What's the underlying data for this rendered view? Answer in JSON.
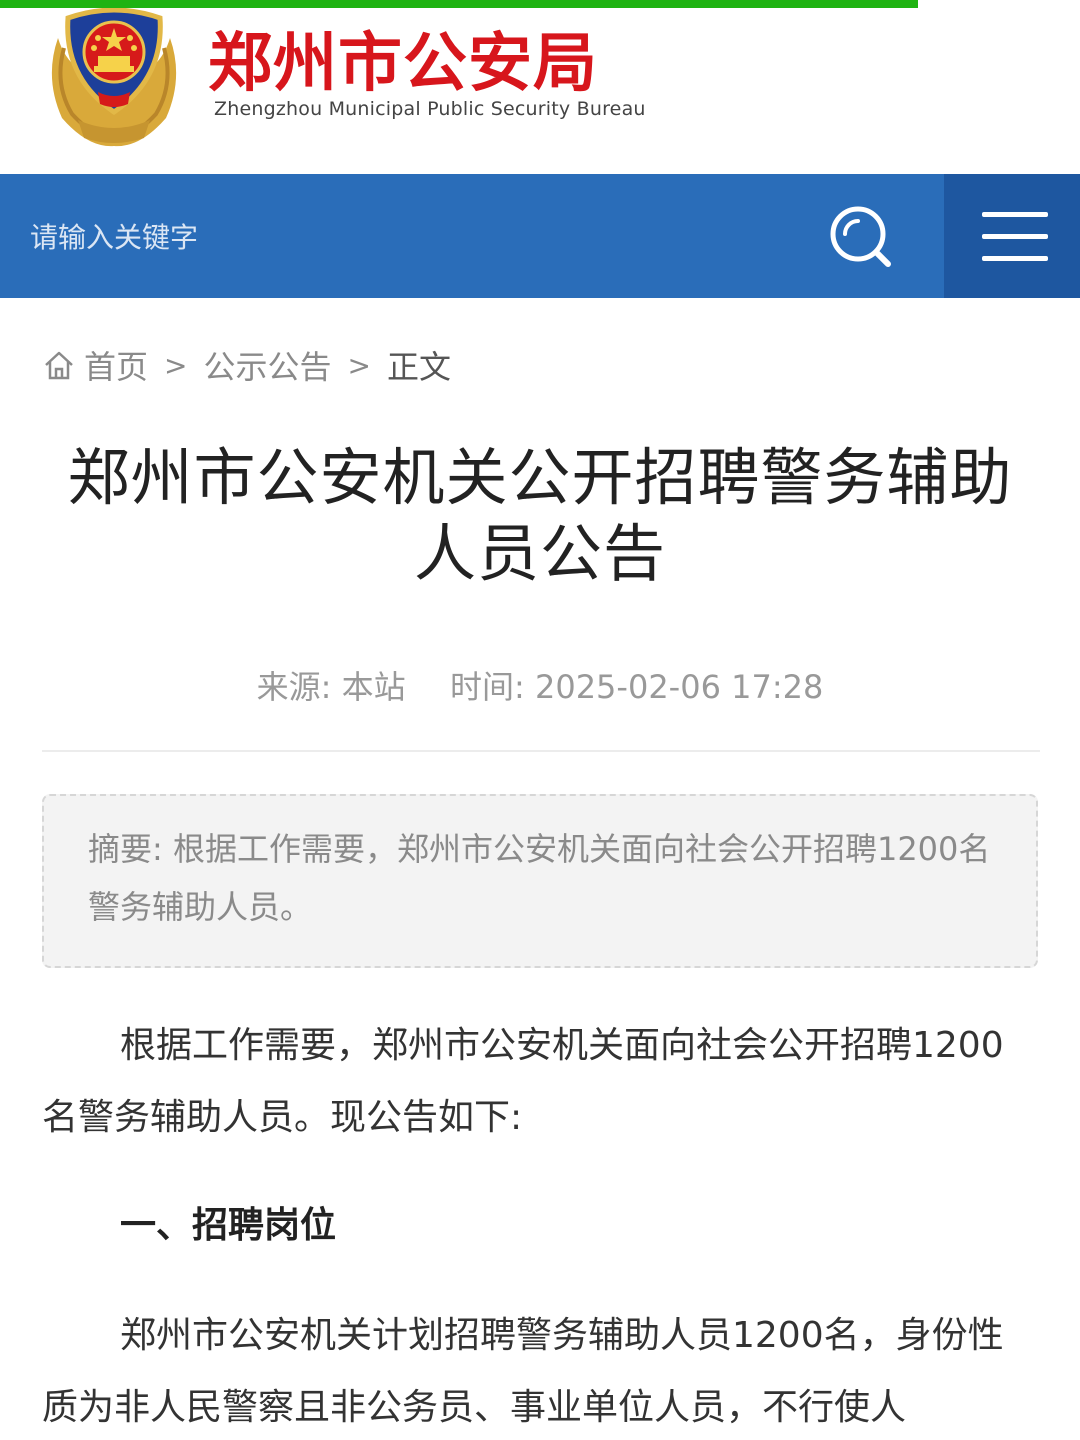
{
  "progress": {
    "fraction": 0.85,
    "color": "#1fb312"
  },
  "header": {
    "title": "郑州市公安局",
    "subtitle": "Zhengzhou Municipal Public Security Bureau",
    "emblem_icon": "police-emblem-icon",
    "title_color": "#d7161c"
  },
  "search": {
    "placeholder": "请输入关键字",
    "search_icon": "search-icon",
    "menu_icon": "hamburger-menu-icon",
    "bar_color": "#2a6db9"
  },
  "breadcrumb": {
    "home_icon": "home-icon",
    "items": [
      "首页",
      "公示公告",
      "正文"
    ],
    "separator": ">"
  },
  "article": {
    "title": "郑州市公安机关公开招聘警务辅助人员公告",
    "source_label": "来源:",
    "source": "本站",
    "time_label": "时间:",
    "time": "2025-02-06 17:28",
    "summary": "摘要: 根据工作需要，郑州市公安机关面向社会公开招聘1200名警务辅助人员。",
    "paragraph1": "根据工作需要，郑州市公安机关面向社会公开招聘1200名警务辅助人员。现公告如下:",
    "section1_heading": "一、招聘岗位",
    "paragraph2": "郑州市公安机关计划招聘警务辅助人员1200名，身份性质为非人民警察且非公务员、事业单位人员，不行使人"
  }
}
